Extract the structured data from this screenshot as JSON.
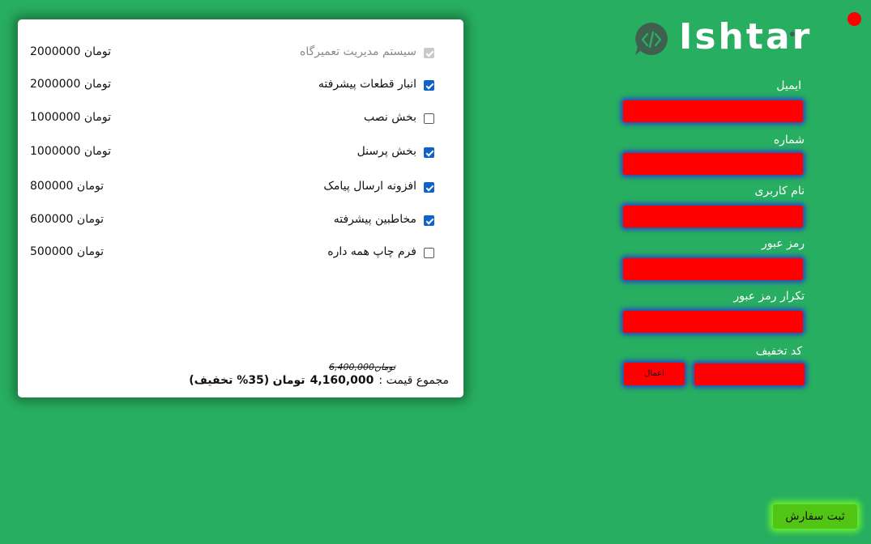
{
  "brand": {
    "name": "Ishtar"
  },
  "packages": {
    "items": [
      {
        "label": "سیستم مدیریت تعمیرگاه",
        "price": "2000000",
        "unit": "تومان",
        "state": "disabled"
      },
      {
        "label": "انبار قطعات پیشرفته",
        "price": "2000000",
        "unit": "تومان",
        "state": "checked"
      },
      {
        "label": "بخش نصب",
        "price": "1000000",
        "unit": "تومان",
        "state": "unchecked"
      },
      {
        "label": "بخش پرسنل",
        "price": "1000000",
        "unit": "تومان",
        "state": "checked"
      },
      {
        "label": "افزونه ارسال پیامک",
        "price": "800000",
        "unit": "تومان",
        "state": "checked"
      },
      {
        "label": "مخاطبین پیشرفته",
        "price": "600000",
        "unit": "تومان",
        "state": "checked"
      },
      {
        "label": "فرم چاپ همه داره",
        "price": "500000",
        "unit": "تومان",
        "state": "unchecked"
      }
    ],
    "old_total": "6,400,000تومان",
    "total_label": "مجموع قیمت :",
    "total_amount": "4,160,000",
    "total_unit": "تومان",
    "discount_note": "(35% تخفیف)"
  },
  "form": {
    "email_label": "ایمیل",
    "phone_label": "شماره",
    "username_label": "نام کاربری",
    "password_label": "رمز عبور",
    "password_confirm_label": "تکرار رمز عبور",
    "discount_label": "کد تخفیف",
    "apply_label": "اعمال",
    "submit_label": "ثبت سفارش"
  },
  "colors": {
    "background": "#27ae60",
    "input_fill": "#ff0000",
    "checkbox_checked": "#0f62c9",
    "submit": "#52c413"
  }
}
